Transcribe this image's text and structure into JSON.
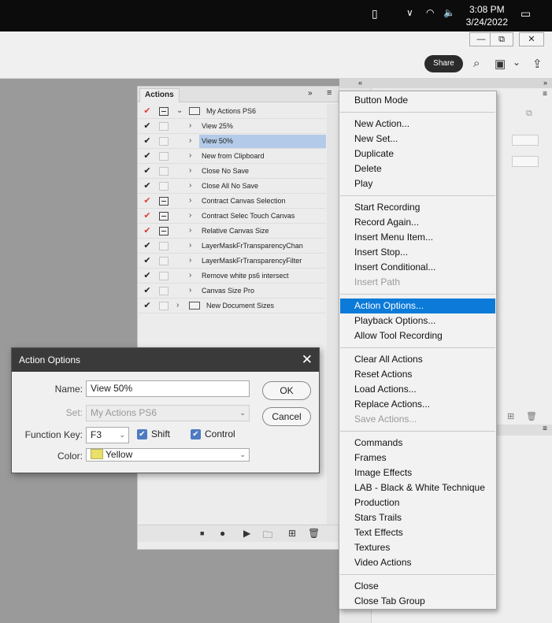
{
  "taskbar": {
    "time": "3:08 PM",
    "date": "3/24/2022"
  },
  "topbar": {
    "share_label": "Share"
  },
  "actions_panel": {
    "tab": "Actions",
    "rows": [
      {
        "check": "✔",
        "check_color": "#e23b3b",
        "dialog": true,
        "name": "My Actions PS6",
        "type": "set",
        "expanded": true
      },
      {
        "check": "✔",
        "check_color": "#222222",
        "dialog": false,
        "name": "View 25%",
        "type": "action"
      },
      {
        "check": "✔",
        "check_color": "#222222",
        "dialog": false,
        "name": "View 50%",
        "type": "action",
        "selected": true
      },
      {
        "check": "✔",
        "check_color": "#222222",
        "dialog": false,
        "name": "New from Clipboard",
        "type": "action"
      },
      {
        "check": "✔",
        "check_color": "#222222",
        "dialog": false,
        "name": "Close No Save",
        "type": "action"
      },
      {
        "check": "✔",
        "check_color": "#222222",
        "dialog": false,
        "name": "Close All No Save",
        "type": "action"
      },
      {
        "check": "✔",
        "check_color": "#e23b3b",
        "dialog": true,
        "name": "Contract Canvas Selection",
        "type": "action"
      },
      {
        "check": "✔",
        "check_color": "#e23b3b",
        "dialog": true,
        "name": "Contract Selec Touch Canvas",
        "type": "action"
      },
      {
        "check": "✔",
        "check_color": "#e23b3b",
        "dialog": true,
        "name": "Relative Canvas Size",
        "type": "action"
      },
      {
        "check": "✔",
        "check_color": "#222222",
        "dialog": false,
        "name": "LayerMaskFrTransparencyChan",
        "type": "action"
      },
      {
        "check": "✔",
        "check_color": "#222222",
        "dialog": false,
        "name": "LayerMaskFrTransparencyFilter",
        "type": "action"
      },
      {
        "check": "✔",
        "check_color": "#222222",
        "dialog": false,
        "name": "Remove white ps6 intersect",
        "type": "action"
      },
      {
        "check": "✔",
        "check_color": "#222222",
        "dialog": false,
        "name": "Canvas Size Pro",
        "type": "action"
      },
      {
        "check": "✔",
        "check_color": "#222222",
        "dialog": false,
        "name": "New Document Sizes",
        "type": "set",
        "expanded": false
      }
    ]
  },
  "menu": {
    "groups": [
      [
        {
          "label": "Button Mode"
        }
      ],
      [
        {
          "label": "New Action..."
        },
        {
          "label": "New Set..."
        },
        {
          "label": "Duplicate"
        },
        {
          "label": "Delete"
        },
        {
          "label": "Play"
        }
      ],
      [
        {
          "label": "Start Recording"
        },
        {
          "label": "Record Again..."
        },
        {
          "label": "Insert Menu Item..."
        },
        {
          "label": "Insert Stop..."
        },
        {
          "label": "Insert Conditional..."
        },
        {
          "label": "Insert Path",
          "disabled": true
        }
      ],
      [
        {
          "label": "Action Options...",
          "highlighted": true
        },
        {
          "label": "Playback Options..."
        },
        {
          "label": "Allow Tool Recording"
        }
      ],
      [
        {
          "label": "Clear All Actions"
        },
        {
          "label": "Reset Actions"
        },
        {
          "label": "Load Actions..."
        },
        {
          "label": "Replace Actions..."
        },
        {
          "label": "Save Actions...",
          "disabled": true
        }
      ],
      [
        {
          "label": "Commands"
        },
        {
          "label": "Frames"
        },
        {
          "label": "Image Effects"
        },
        {
          "label": "LAB - Black & White Technique"
        },
        {
          "label": "Production"
        },
        {
          "label": "Stars Trails"
        },
        {
          "label": "Text Effects"
        },
        {
          "label": "Textures"
        },
        {
          "label": "Video Actions"
        }
      ],
      [
        {
          "label": "Close"
        },
        {
          "label": "Close Tab Group"
        }
      ]
    ]
  },
  "dialog": {
    "title": "Action Options",
    "name_label": "Name:",
    "name_value": "View 50%",
    "set_label": "Set:",
    "set_value": "My Actions PS6",
    "function_key_label": "Function Key:",
    "function_key_value": "F3",
    "shift_label": "Shift",
    "shift_checked": true,
    "control_label": "Control",
    "control_checked": true,
    "color_label": "Color:",
    "color_value": "Yellow",
    "ok_label": "OK",
    "cancel_label": "Cancel"
  }
}
